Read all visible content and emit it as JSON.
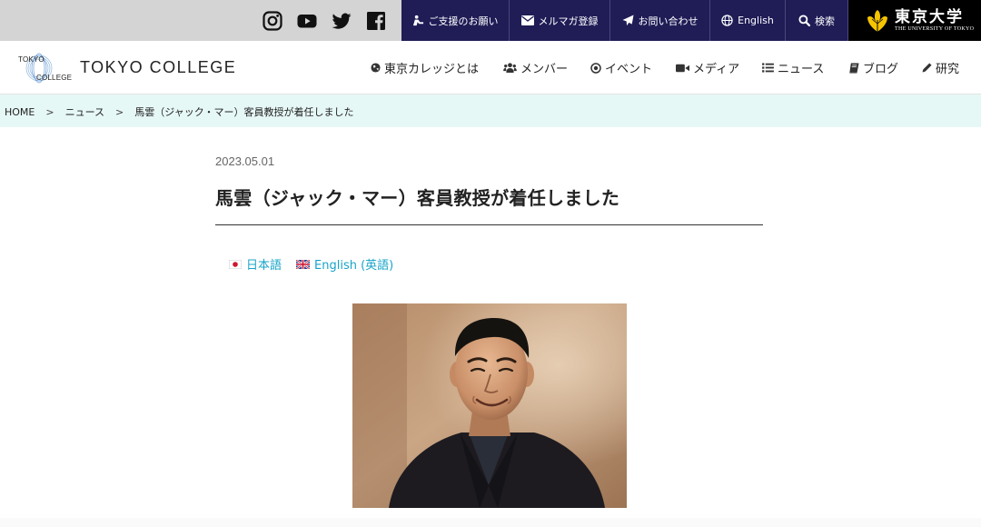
{
  "topbar": {
    "social": [
      {
        "icon": "instagram-icon"
      },
      {
        "icon": "youtube-icon"
      },
      {
        "icon": "twitter-icon"
      },
      {
        "icon": "facebook-icon"
      }
    ],
    "utility": [
      {
        "icon": "support-icon",
        "label": "ご支援のお願い"
      },
      {
        "icon": "mail-icon",
        "label": "メルマガ登録"
      },
      {
        "icon": "send-icon",
        "label": "お問い合わせ"
      },
      {
        "icon": "globe-icon",
        "label": "English"
      },
      {
        "icon": "search-icon",
        "label": "検索"
      }
    ],
    "utokyo": {
      "jp": "東京大学",
      "en": "THE UNIVERSITY OF TOKYO"
    }
  },
  "header": {
    "logo_top": "TOKYO",
    "logo_bottom": "COLLEGE",
    "site_name": "TOKYO COLLEGE",
    "nav": [
      {
        "icon": "globe-icon",
        "label": "東京カレッジとは"
      },
      {
        "icon": "users-icon",
        "label": "メンバー"
      },
      {
        "icon": "dot-circle-icon",
        "label": "イベント"
      },
      {
        "icon": "video-icon",
        "label": "メディア"
      },
      {
        "icon": "list-icon",
        "label": "ニュース"
      },
      {
        "icon": "book-icon",
        "label": "ブログ"
      },
      {
        "icon": "pencil-icon",
        "label": "研究"
      }
    ]
  },
  "breadcrumb": {
    "items": [
      "HOME",
      "ニュース",
      "馬雲（ジャック・マー）客員教授が着任しました"
    ],
    "separator": ">"
  },
  "article": {
    "date": "2023.05.01",
    "title": "馬雲（ジャック・マー）客員教授が着任しました",
    "languages": [
      {
        "flag": "japan-flag-icon",
        "label": "日本語"
      },
      {
        "flag": "uk-flag-icon",
        "label": "English (英語)"
      }
    ],
    "photo": "portrait-photo"
  },
  "colors": {
    "utility_bg": "#1f1c56",
    "topbar_bg": "#d4d4d4",
    "breadcrumb_bg": "#e6f8f6",
    "link": "#18a4c8"
  }
}
